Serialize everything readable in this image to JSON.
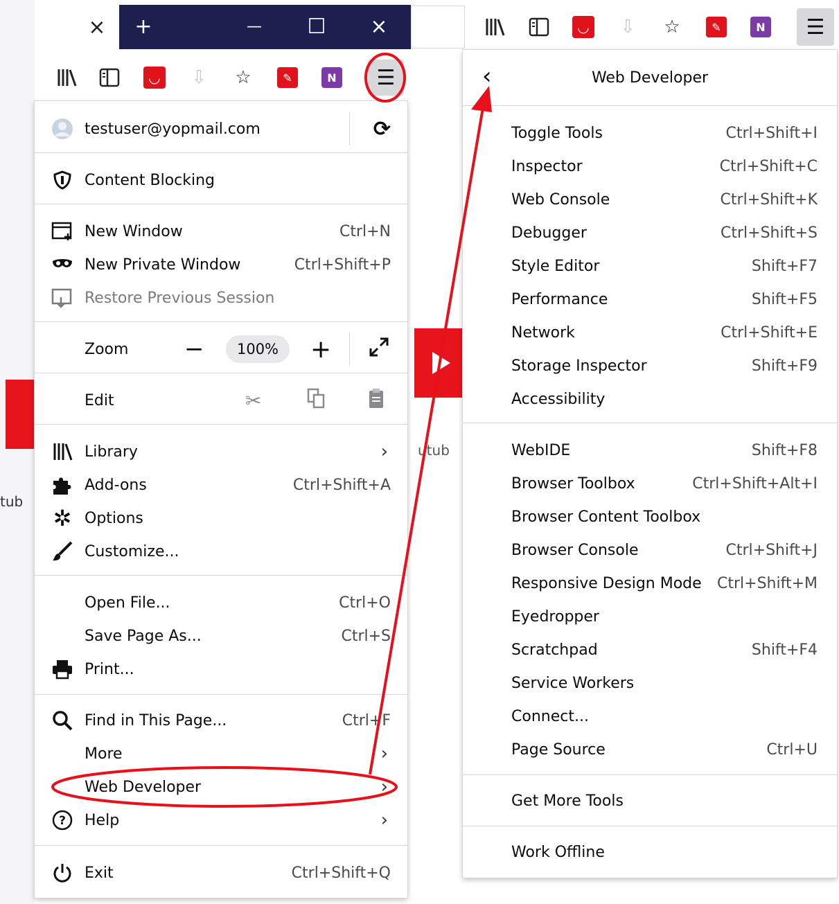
{
  "window": {
    "tab_close": "×",
    "new_tab": "+",
    "minimize": "—",
    "maximize": "☐",
    "close": "×"
  },
  "background_text": {
    "left_fragment": "tub",
    "middle_fragment": "utub"
  },
  "main_menu": {
    "account": {
      "email": "testuser@yopmail.com",
      "sync_icon": "sync-icon"
    },
    "content_blocking": "Content Blocking",
    "new_window": {
      "label": "New Window",
      "shortcut": "Ctrl+N"
    },
    "new_private_window": {
      "label": "New Private Window",
      "shortcut": "Ctrl+Shift+P"
    },
    "restore_session": "Restore Previous Session",
    "zoom": {
      "label": "Zoom",
      "minus": "−",
      "value": "100%",
      "plus": "+"
    },
    "edit": {
      "label": "Edit"
    },
    "library": {
      "label": "Library"
    },
    "addons": {
      "label": "Add-ons",
      "shortcut": "Ctrl+Shift+A"
    },
    "options": {
      "label": "Options"
    },
    "customize": {
      "label": "Customize..."
    },
    "open_file": {
      "label": "Open File...",
      "shortcut": "Ctrl+O"
    },
    "save_page": {
      "label": "Save Page As...",
      "shortcut": "Ctrl+S"
    },
    "print": {
      "label": "Print..."
    },
    "find": {
      "label": "Find in This Page...",
      "shortcut": "Ctrl+F"
    },
    "more": {
      "label": "More"
    },
    "web_developer": {
      "label": "Web Developer"
    },
    "help": {
      "label": "Help"
    },
    "exit": {
      "label": "Exit",
      "shortcut": "Ctrl+Shift+Q"
    }
  },
  "dev_menu": {
    "title": "Web Developer",
    "items": [
      {
        "label": "Toggle Tools",
        "shortcut": "Ctrl+Shift+I"
      },
      {
        "label": "Inspector",
        "shortcut": "Ctrl+Shift+C"
      },
      {
        "label": "Web Console",
        "shortcut": "Ctrl+Shift+K"
      },
      {
        "label": "Debugger",
        "shortcut": "Ctrl+Shift+S"
      },
      {
        "label": "Style Editor",
        "shortcut": "Shift+F7"
      },
      {
        "label": "Performance",
        "shortcut": "Shift+F5"
      },
      {
        "label": "Network",
        "shortcut": "Ctrl+Shift+E"
      },
      {
        "label": "Storage Inspector",
        "shortcut": "Shift+F9"
      },
      {
        "label": "Accessibility",
        "shortcut": ""
      },
      {
        "label": "WebIDE",
        "shortcut": "Shift+F8"
      },
      {
        "label": "Browser Toolbox",
        "shortcut": "Ctrl+Shift+Alt+I"
      },
      {
        "label": "Browser Content Toolbox",
        "shortcut": ""
      },
      {
        "label": "Browser Console",
        "shortcut": "Ctrl+Shift+J"
      },
      {
        "label": "Responsive Design Mode",
        "shortcut": "Ctrl+Shift+M"
      },
      {
        "label": "Eyedropper",
        "shortcut": ""
      },
      {
        "label": "Scratchpad",
        "shortcut": "Shift+F4"
      },
      {
        "label": "Service Workers",
        "shortcut": ""
      },
      {
        "label": "Connect...",
        "shortcut": ""
      },
      {
        "label": "Page Source",
        "shortcut": "Ctrl+U"
      },
      {
        "label": "Get More Tools",
        "shortcut": ""
      },
      {
        "label": "Work Offline",
        "shortcut": ""
      }
    ]
  },
  "colors": {
    "annotation_red": "#e8101a",
    "titlebar": "#1d1f4f",
    "hover_gray": "#d8d8db"
  }
}
